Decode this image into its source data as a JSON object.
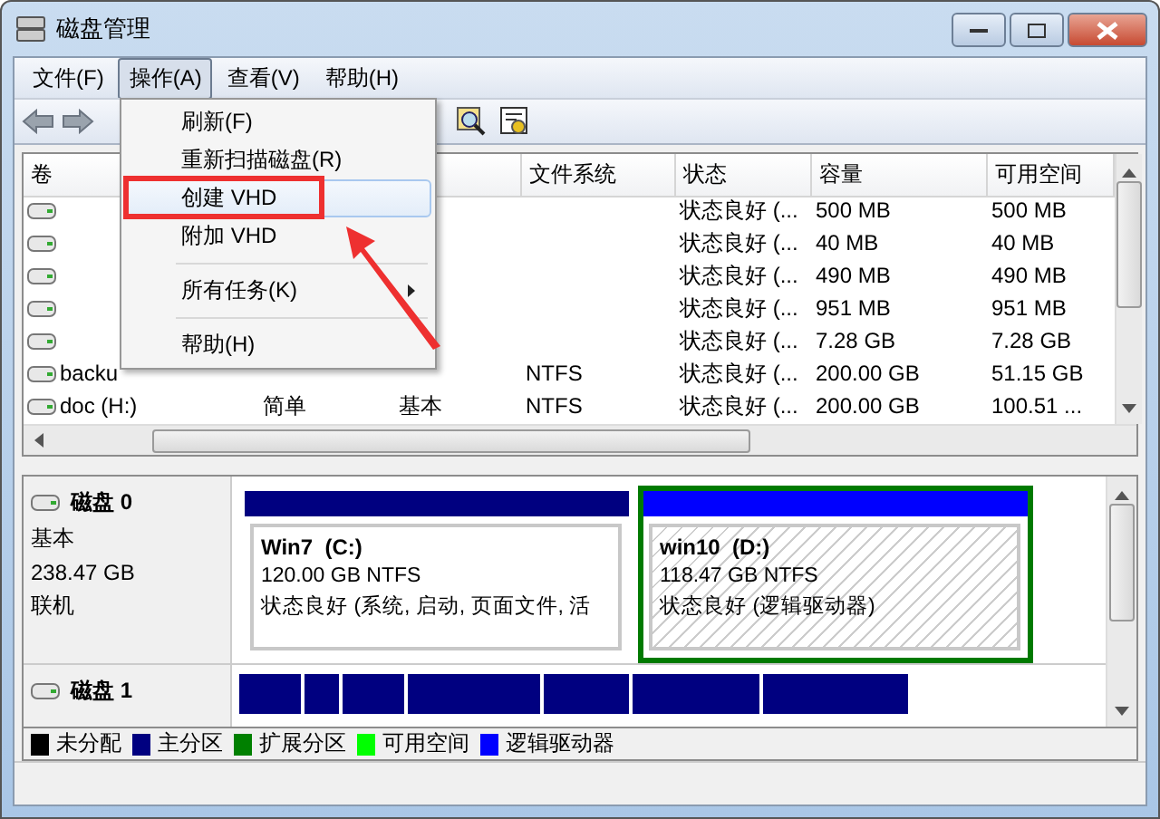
{
  "window": {
    "title": "磁盘管理"
  },
  "menu_bar": [
    {
      "label": "文件(F)",
      "selected": false
    },
    {
      "label": "操作(A)",
      "selected": true
    },
    {
      "label": "查看(V)",
      "selected": false
    },
    {
      "label": "帮助(H)",
      "selected": false
    }
  ],
  "open_menu": {
    "items": [
      {
        "kind": "item",
        "label": "刷新(F)",
        "highlighted": false
      },
      {
        "kind": "item",
        "label": "重新扫描磁盘(R)",
        "highlighted": false
      },
      {
        "kind": "item",
        "label": "创建 VHD",
        "highlighted": true
      },
      {
        "kind": "item",
        "label": "附加 VHD",
        "highlighted": false
      },
      {
        "kind": "separator"
      },
      {
        "kind": "submenu",
        "label": "所有任务(K)",
        "highlighted": false
      },
      {
        "kind": "separator"
      },
      {
        "kind": "item",
        "label": "帮助(H)",
        "highlighted": false
      }
    ]
  },
  "table": {
    "columns": [
      "卷",
      "文件系统",
      "状态",
      "容量",
      "可用空间"
    ],
    "rows": [
      {
        "status": "状态良好 (...",
        "capacity": "500 MB",
        "free": "500 MB"
      },
      {
        "status": "状态良好 (...",
        "capacity": "40 MB",
        "free": "40 MB"
      },
      {
        "status": "状态良好 (...",
        "capacity": "490 MB",
        "free": "490 MB"
      },
      {
        "status": "状态良好 (...",
        "capacity": "951 MB",
        "free": "951 MB"
      },
      {
        "status": "状态良好 (...",
        "capacity": "7.28 GB",
        "free": "7.28 GB"
      },
      {
        "volume": "backu",
        "fs": "NTFS",
        "status": "状态良好 (...",
        "capacity": "200.00 GB",
        "free": "51.15 GB"
      },
      {
        "volume": "doc (H:)",
        "layout": "简单",
        "type": "基本",
        "fs": "NTFS",
        "status": "状态良好 (...",
        "capacity": "200.00 GB",
        "free": "100.51 ..."
      }
    ]
  },
  "disks": [
    {
      "name": "磁盘 0",
      "type": "基本",
      "size": "238.47 GB",
      "state": "联机",
      "partitions": [
        {
          "kind": "primary",
          "name": "Win7  (C:)",
          "size": "120.00 GB NTFS",
          "status": "状态良好 (系统, 启动, 页面文件, 活",
          "selected": false
        },
        {
          "kind": "logical",
          "name": "win10  (D:)",
          "size": "118.47 GB NTFS",
          "status": "状态良好 (逻辑驱动器)",
          "selected": true
        }
      ]
    },
    {
      "name": "磁盘 1",
      "segments": [
        {
          "kind": "primary"
        },
        {
          "kind": "primary"
        },
        {
          "kind": "primary"
        },
        {
          "kind": "primary"
        },
        {
          "kind": "primary"
        },
        {
          "kind": "primary"
        },
        {
          "kind": "primary"
        }
      ]
    }
  ],
  "legend": [
    {
      "label": "未分配",
      "color": "#000000"
    },
    {
      "label": "主分区",
      "color": "#000080"
    },
    {
      "label": "扩展分区",
      "color": "#008000"
    },
    {
      "label": "可用空间",
      "color": "#00ff00"
    },
    {
      "label": "逻辑驱动器",
      "color": "#0000ff"
    }
  ]
}
